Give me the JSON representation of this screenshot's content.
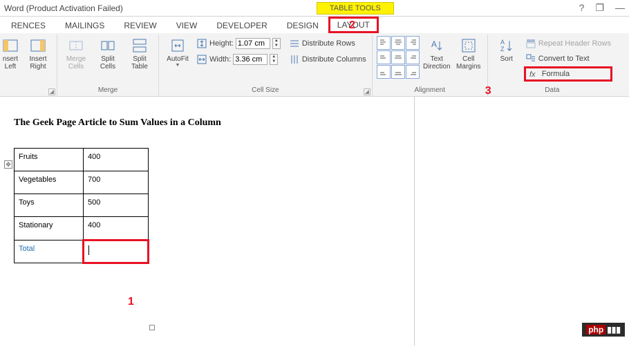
{
  "titlebar": {
    "title": "Word (Product Activation Failed)",
    "tools_tab": "TABLE TOOLS",
    "help": "?",
    "restore": "❐",
    "minimize": "—"
  },
  "tabs": {
    "references": "RENCES",
    "mailings": "MAILINGS",
    "review": "REVIEW",
    "view": "VIEW",
    "developer": "DEVELOPER",
    "design": "DESIGN",
    "layout": "LAYOUT"
  },
  "ribbon": {
    "rows_cols": {
      "insert_left": "nsert\nLeft",
      "insert_right": "Insert\nRight"
    },
    "merge": {
      "label": "Merge",
      "merge_cells": "Merge\nCells",
      "split_cells": "Split\nCells",
      "split_table": "Split\nTable"
    },
    "cell_size": {
      "label": "Cell Size",
      "autofit": "AutoFit",
      "height_label": "Height:",
      "height_value": "1.07 cm",
      "width_label": "Width:",
      "width_value": "3.36 cm",
      "distribute_rows": "Distribute Rows",
      "distribute_cols": "Distribute Columns"
    },
    "alignment": {
      "label": "Alignment",
      "text_direction": "Text\nDirection",
      "cell_margins": "Cell\nMargins"
    },
    "data": {
      "label": "Data",
      "sort": "Sort",
      "repeat_header": "Repeat Header Rows",
      "convert_text": "Convert to Text",
      "formula": "Formula"
    }
  },
  "annotations": {
    "n1": "1",
    "n2": "2",
    "n3": "3"
  },
  "document": {
    "heading": "The Geek Page Article to Sum Values in a Column",
    "table": {
      "rows": [
        {
          "label": "Fruits",
          "value": "400"
        },
        {
          "label": "Vegetables",
          "value": "700"
        },
        {
          "label": "Toys",
          "value": "500"
        },
        {
          "label": "Stationary",
          "value": "400"
        }
      ],
      "total_label": "Total"
    }
  },
  "watermark": {
    "brand": "php",
    "rest": "▮▮▮"
  }
}
